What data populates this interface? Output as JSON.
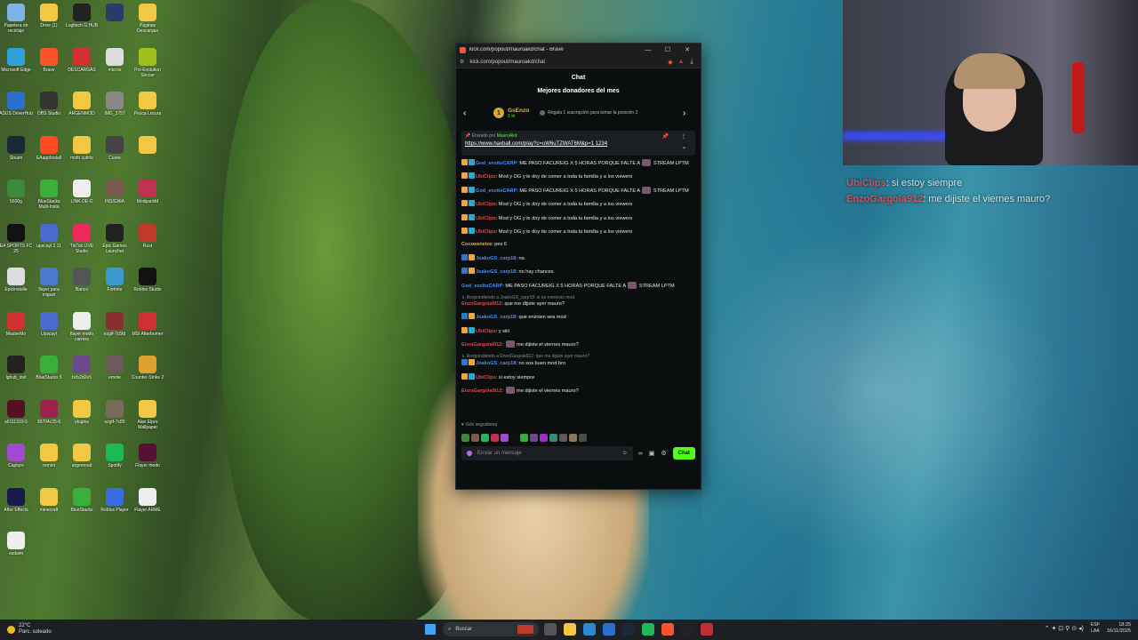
{
  "desktop": {
    "icons": [
      {
        "label": "Papelera de reciclaje",
        "color": "#7fb3e8"
      },
      {
        "label": "Drive (1)",
        "color": "#f2c744"
      },
      {
        "label": "Logitech G HUB",
        "color": "#222222"
      },
      {
        "label": "",
        "color": "#2a3a6a"
      },
      {
        "label": "Páginas Descargas",
        "color": "#f2c744"
      },
      {
        "label": "Microsoft Edge",
        "color": "#2fa0d8"
      },
      {
        "label": "Brave",
        "color": "#fb542b"
      },
      {
        "label": "DESCARGAS",
        "color": "#d23030"
      },
      {
        "label": "micros",
        "color": "#dddddd"
      },
      {
        "label": "Pro Evolution Soccer",
        "color": "#a0c020"
      },
      {
        "label": "ASUS DriverHub",
        "color": "#2a6fd0"
      },
      {
        "label": "OBS Studio",
        "color": "#333333"
      },
      {
        "label": "ARGENMOD",
        "color": "#f2c744"
      },
      {
        "label": "IMG_3757",
        "color": "#888888"
      },
      {
        "label": "Pesca Locura",
        "color": "#f2c744"
      },
      {
        "label": "Steam",
        "color": "#1b2838"
      },
      {
        "label": "EAappInstall",
        "color": "#ff4a22"
      },
      {
        "label": "mofo cutirts",
        "color": "#f2c744"
      },
      {
        "label": "Cuore",
        "color": "#444444"
      },
      {
        "label": "",
        "color": "#f2c744"
      },
      {
        "label": "5600g",
        "color": "#3a8a3a"
      },
      {
        "label": "BlueStacks Multi-Insta",
        "color": "#3ab03a"
      },
      {
        "label": "LINK-DE-D",
        "color": "#eeeeee"
      },
      {
        "label": "INSIGNIA",
        "color": "#7a5a4a"
      },
      {
        "label": "ModpackM",
        "color": "#c03050"
      },
      {
        "label": "EA SPORTS FC 25",
        "color": "#111111"
      },
      {
        "label": "upscayl 2.11",
        "color": "#4a6ad0"
      },
      {
        "label": "TikTok LIVE Studio",
        "color": "#ee2a5a"
      },
      {
        "label": "Epic Games Launcher",
        "color": "#222222"
      },
      {
        "label": "Rust",
        "color": "#c03a2a"
      },
      {
        "label": "Epicinstalle",
        "color": "#dddddd"
      },
      {
        "label": "flayer para miguel",
        "color": "#4a7ad0"
      },
      {
        "label": "Banco",
        "color": "#555555"
      },
      {
        "label": "Fortnite",
        "color": "#3a9ad0"
      },
      {
        "label": "Roblox Studio",
        "color": "#111111"
      },
      {
        "label": "MasterMo",
        "color": "#d03030"
      },
      {
        "label": "Upscayl",
        "color": "#4a6ad0"
      },
      {
        "label": "flayer modo carrera",
        "color": "#eeeeee"
      },
      {
        "label": "ezgif-7c5fd",
        "color": "#883030"
      },
      {
        "label": "MSI Afterburner",
        "color": "#d03030"
      },
      {
        "label": "lghub_inst",
        "color": "#222222"
      },
      {
        "label": "BlueStacks 5",
        "color": "#3ab03a"
      },
      {
        "label": "bcb2d2e5",
        "color": "#6a4a8a"
      },
      {
        "label": "emote",
        "color": "#6a5a5a"
      },
      {
        "label": "Counter-Strike 2",
        "color": "#e0a030"
      },
      {
        "label": "a6111310-5",
        "color": "#551122"
      },
      {
        "label": "39704c35-6",
        "color": "#a02050"
      },
      {
        "label": "plugins",
        "color": "#f2c744"
      },
      {
        "label": "ezgif-7c85",
        "color": "#7a6a5a"
      },
      {
        "label": "Alan Elpro Wallpaper",
        "color": "#f2c744"
      },
      {
        "label": "Capture",
        "color": "#a04ad0"
      },
      {
        "label": "remini",
        "color": "#f2c744"
      },
      {
        "label": "argenmod",
        "color": "#f2c744"
      },
      {
        "label": "Spotify",
        "color": "#1db954"
      },
      {
        "label": "Flayer modo",
        "color": "#551133"
      },
      {
        "label": "After Effects",
        "color": "#1a1a4a"
      },
      {
        "label": "minecraft",
        "color": "#f2c744"
      },
      {
        "label": "BlueStacks",
        "color": "#3ab03a"
      },
      {
        "label": "Roblox Player",
        "color": "#3a6ae0"
      },
      {
        "label": "Flayer ARME",
        "color": "#eeeeee"
      },
      {
        "label": "ezdaim",
        "color": "#eeeeee"
      }
    ]
  },
  "browser": {
    "title": "kick.com/popout/mauroakd/chat - Brave",
    "url": "kick.com/popout/mauroakd/chat",
    "minimize": "—",
    "maximize": "☐",
    "close": "✕",
    "chat_header": "Chat",
    "donors": {
      "title": "Mejores donadores del mes",
      "rank": "1",
      "name": "GsEnzo",
      "count": "1 ✉",
      "cta": "Regala 1 suscripción para tomar la posición 2"
    },
    "pinned": {
      "by_prefix": "Enviado por",
      "by_user": "MauroAkd",
      "link": "https://www.haxball.com/play?c=uW6uTZWAT6M&p=1 1234"
    },
    "messages": [
      {
        "reply": "",
        "user": "God_enzitoCARP",
        "user_color": "#4a8ef0",
        "badges": [
          "#f2a33a",
          "#2aa8d0"
        ],
        "text": ": ME PASO FACUREIG X 5 HORAS PORQUE FALTE A ",
        "emote": true,
        "tail": " STREAM LPTM"
      },
      {
        "reply": "",
        "user": "UbiClips",
        "user_color": "#e24848",
        "badges": [
          "#f2a33a",
          "#2aa8d0"
        ],
        "text": ": Mod y OG y le doy de comer a toda tu familia y a los viewers",
        "emote": false,
        "tail": ""
      },
      {
        "reply": "",
        "user": "God_enzitoCARP",
        "user_color": "#4a8ef0",
        "badges": [
          "#f2a33a",
          "#2aa8d0"
        ],
        "text": ": ME PASO FACUREIG X 5 HORAS PORQUE FALTE A ",
        "emote": true,
        "tail": " STREAM LPTM"
      },
      {
        "reply": "",
        "user": "UbiClips",
        "user_color": "#e24848",
        "badges": [
          "#f2a33a",
          "#2aa8d0"
        ],
        "text": ": Mod y OG y le doy de comer a toda tu familia y a los viewers",
        "emote": false,
        "tail": ""
      },
      {
        "reply": "",
        "user": "UbiClips",
        "user_color": "#e24848",
        "badges": [
          "#f2a33a",
          "#2aa8d0"
        ],
        "text": ": Mod y OG y le doy de comer a toda tu familia y a los viewers",
        "emote": false,
        "tail": ""
      },
      {
        "reply": "",
        "user": "UbiClips",
        "user_color": "#e24848",
        "badges": [
          "#f2a33a",
          "#2aa8d0"
        ],
        "text": ": Mod y OG y le doy de comer a toda tu familia y a los viewers",
        "emote": false,
        "tail": ""
      },
      {
        "reply": "",
        "user": "Cocoxeneize",
        "user_color": "#e8b63a",
        "badges": [],
        "text": ": pes 6",
        "emote": false,
        "tail": ""
      },
      {
        "reply": "",
        "user": "JoakoGS_carp18",
        "user_color": "#4a8ef0",
        "badges": [
          "#2a7ad0",
          "#f2a33a"
        ],
        "text": ": na",
        "emote": false,
        "tail": ""
      },
      {
        "reply": "",
        "user": "JoakoGS_carp18",
        "user_color": "#4a8ef0",
        "badges": [
          "#2a7ad0",
          "#f2a33a"
        ],
        "text": ": no hay chances",
        "emote": false,
        "tail": ""
      },
      {
        "reply": "",
        "user": "God_enzitoCARP",
        "user_color": "#4a8ef0",
        "badges": [],
        "text": ": ME PASO FACUREIG X 5 HORAS PORQUE FALTE A ",
        "emote": true,
        "tail": " STREAM LPTM"
      },
      {
        "reply": "↳ Respondiendo a JoakoGS_carp18: si no mereces mod",
        "user": "EnzoGargolal912",
        "user_color": "#e24848",
        "badges": [],
        "text": ": que me dijiste ayer mauro?",
        "emote": false,
        "tail": ""
      },
      {
        "reply": "",
        "user": "JoakoGS_carp18",
        "user_color": "#4a8ef0",
        "badges": [
          "#2a7ad0",
          "#f2a33a"
        ],
        "text": ": que enzown sea mod",
        "emote": false,
        "tail": ""
      },
      {
        "reply": "",
        "user": "UbiClips",
        "user_color": "#e24848",
        "badges": [
          "#f2a33a",
          "#2aa8d0"
        ],
        "text": ": y siiii",
        "emote": false,
        "tail": ""
      },
      {
        "reply": "",
        "user": "EnzoGargolal912",
        "user_color": "#e24848",
        "badges": [],
        "text": ": ",
        "emote": true,
        "tail": " me dijiste el viernes mauro?"
      },
      {
        "reply": "↳ Respondiendo a EnzoGargola912: que me dijiste ayer mauro?",
        "user": "JoakoGS_carp18",
        "user_color": "#4a8ef0",
        "badges": [
          "#2a7ad0",
          "#f2a33a"
        ],
        "text": ": no sos buen mod bro",
        "emote": false,
        "tail": ""
      },
      {
        "reply": "",
        "user": "UbiClips",
        "user_color": "#e24848",
        "badges": [
          "#f2a33a",
          "#2aa8d0"
        ],
        "text": ": si estoy siempre",
        "emote": false,
        "tail": ""
      },
      {
        "reply": "",
        "user": "EnzoGargolal912",
        "user_color": "#e24848",
        "badges": [],
        "text": ": ",
        "emote": true,
        "tail": " me dijiste el viernes mauro?"
      }
    ],
    "followers_only": "♥ Solo seguidores",
    "emote_colors": [
      "#3a8a3a",
      "#7a5a4a",
      "#1db954",
      "#c03050",
      "#a04ad0",
      "#111111",
      "#3ab03a",
      "#6a4a8a",
      "#a030c0",
      "#3a8a7a",
      "#5a5a5a",
      "#8a7a5a",
      "#4a4a4a"
    ],
    "composer": {
      "placeholder": "Enviar un mensaje",
      "send": "Chat"
    }
  },
  "overlay_chat": {
    "line1_user": "UbiClips",
    "line1_text": ": si estoy siempre",
    "line2_user": "EnzoGargola912",
    "line2_text": ": me dijiste el viernes mauro?"
  },
  "taskbar": {
    "temp": "22°C",
    "weather": "Parc. soleado",
    "search": "Buscar",
    "lang1": "ESP",
    "lang2": "LAA",
    "time": "18:25",
    "date": "16/11/2025",
    "app_colors": [
      "#555555",
      "#f2c744",
      "#2a8ad0",
      "#2a6fd0",
      "#1b2838",
      "#1db954",
      "#fb542b",
      "#222222",
      "#c03030"
    ]
  }
}
